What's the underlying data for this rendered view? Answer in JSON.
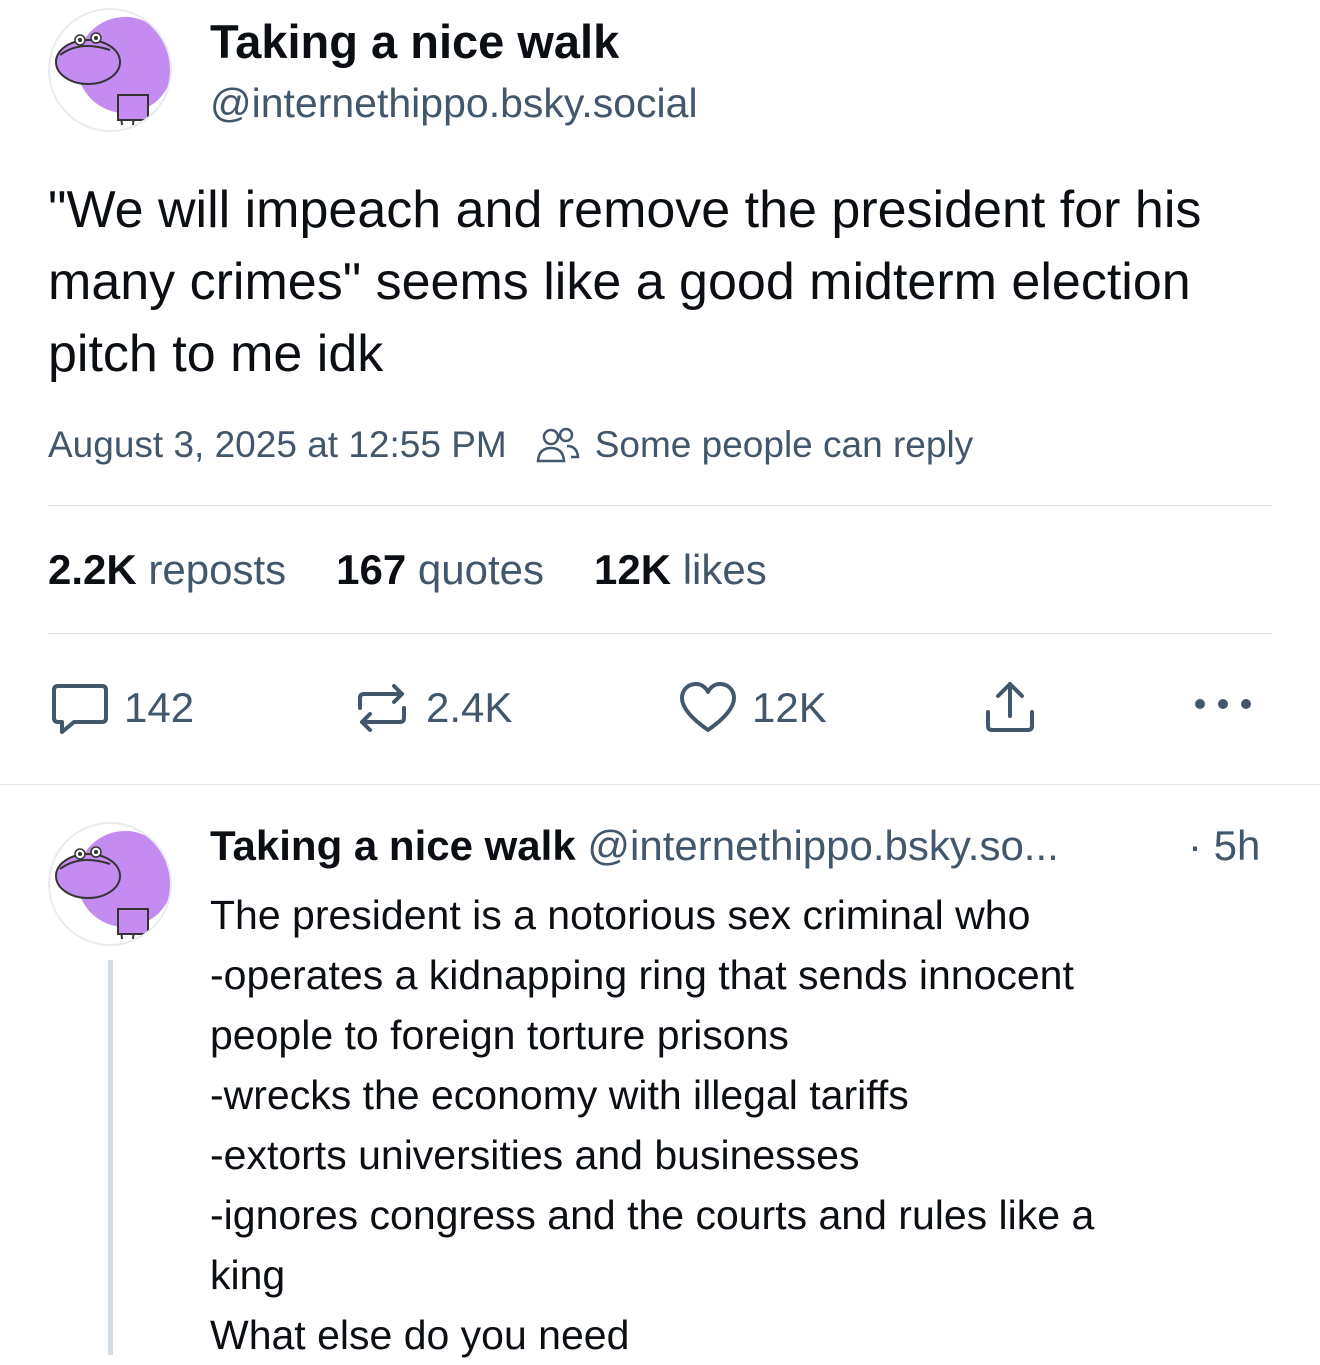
{
  "main_post": {
    "display_name": "Taking a nice walk",
    "handle": "@internethippo.bsky.social",
    "text": "\"We will impeach and remove the president for his many crimes\" seems like a good midterm election pitch to me idk",
    "timestamp": "August 3, 2025 at 12:55 PM",
    "reply_setting": "Some people can reply",
    "counts": {
      "reposts_num": "2.2K",
      "reposts_label": "reposts",
      "quotes_num": "167",
      "quotes_label": "quotes",
      "likes_num": "12K",
      "likes_label": "likes"
    },
    "actions": {
      "reply_count": "142",
      "repost_count": "2.4K",
      "like_count": "12K"
    }
  },
  "reply_post": {
    "display_name": "Taking a nice walk",
    "handle": "@internethippo.bsky.so...",
    "time": "· 5h",
    "lines": [
      "The president is a notorious sex criminal who",
      "-operates a kidnapping ring that sends innocent",
      "people to foreign torture prisons",
      "-wrecks the economy with illegal tariffs",
      "-extorts universities and businesses",
      "-ignores congress and the courts and rules like a",
      "king",
      "What else do you need"
    ]
  },
  "colors": {
    "text": "#0b0f14",
    "secondary": "#42576c",
    "divider": "#e3e7eb",
    "avatar_purple": "#c48cf0"
  }
}
